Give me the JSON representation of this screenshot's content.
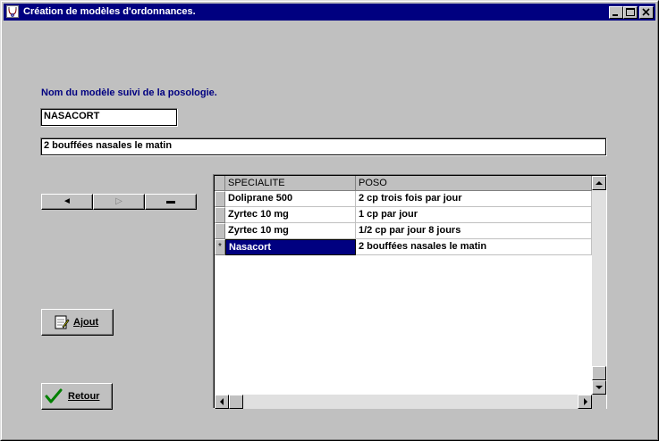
{
  "window": {
    "title": "Création de modèles d'ordonnances.",
    "icon": "prescription-app-icon",
    "controls": [
      "minimize-icon",
      "maximize-icon",
      "close-icon"
    ]
  },
  "form": {
    "label": "Nom du modèle suivi de la posologie.",
    "name_value": "NASACORT",
    "posology_value": "2 bouffées nasales le matin"
  },
  "nav": {
    "prev_glyph": "◄",
    "next_glyph": "▷",
    "delete_glyph": "▬"
  },
  "grid": {
    "columns": [
      "SPECIALITE",
      "POSO"
    ],
    "rows": [
      {
        "specialite": "Doliprane 500",
        "poso": "2 cp trois fois par jour",
        "marker": ""
      },
      {
        "specialite": "Zyrtec 10 mg",
        "poso": "1 cp par jour",
        "marker": ""
      },
      {
        "specialite": "Zyrtec 10 mg",
        "poso": "1/2 cp par jour 8 jours",
        "marker": ""
      },
      {
        "specialite": "Nasacort",
        "poso": "2 bouffées nasales le matin",
        "marker": "*"
      }
    ]
  },
  "buttons": {
    "add_label": "Ajout",
    "add_icon": "document-edit-icon",
    "back_label": "Retour",
    "back_icon": "checkmark-icon"
  },
  "colors": {
    "title_bar": "#000080",
    "label_text": "#000080",
    "selection": "#000080",
    "face": "#c0c0c0",
    "checkmark": "#008000"
  }
}
